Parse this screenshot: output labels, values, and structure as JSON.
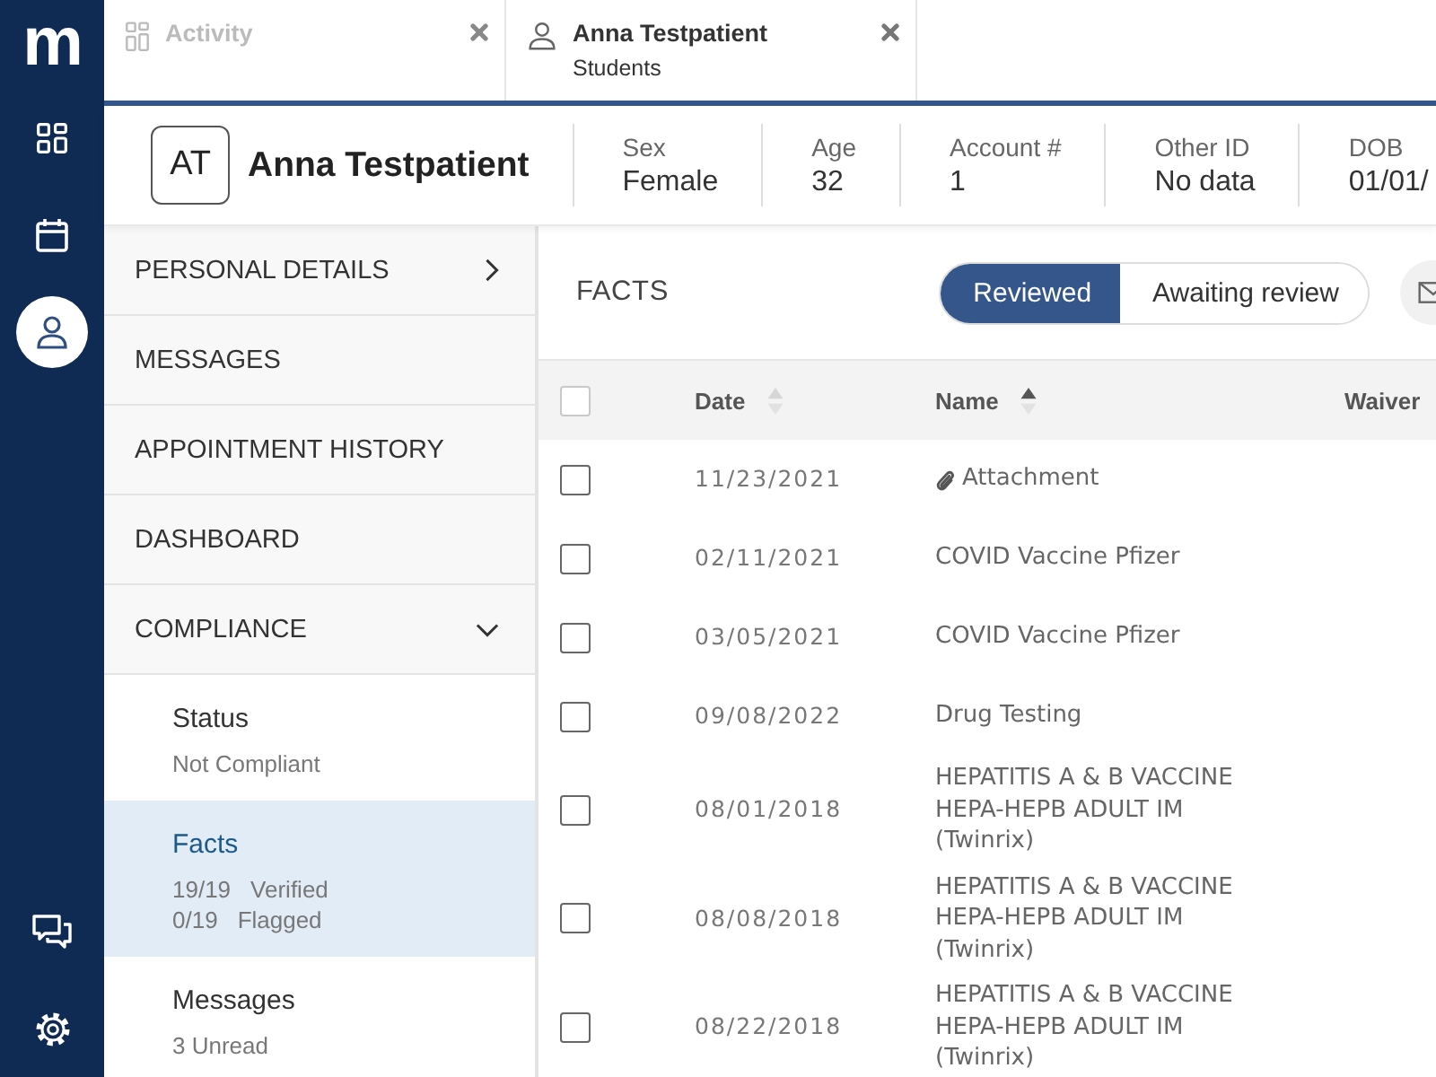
{
  "rail": {
    "logo": "m",
    "items": [
      {
        "selected": false
      },
      {
        "selected": false
      },
      {
        "selected": true
      }
    ]
  },
  "tabs": [
    {
      "label": "Activity",
      "selected": false
    },
    {
      "label": "Anna Testpatient",
      "sublabel": "Students",
      "selected": true
    }
  ],
  "patient": {
    "initials": "AT",
    "name": "Anna Testpatient",
    "fields": [
      {
        "label": "Sex",
        "value": "Female"
      },
      {
        "label": "Age",
        "value": "32"
      },
      {
        "label": "Account #",
        "value": "1"
      },
      {
        "label": "Other ID",
        "value": "No data"
      },
      {
        "label": "DOB",
        "value": "01/01/"
      }
    ]
  },
  "sidebar": {
    "items": [
      {
        "label": "PERSONAL DETAILS",
        "kind": "section",
        "expanded": false
      },
      {
        "label": "MESSAGES",
        "kind": "link"
      },
      {
        "label": "APPOINTMENT HISTORY",
        "kind": "link"
      },
      {
        "label": "DASHBOARD",
        "kind": "link"
      },
      {
        "label": "COMPLIANCE",
        "kind": "section",
        "expanded": true,
        "children": [
          {
            "title": "Status",
            "details": [
              {
                "text": "Not Compliant"
              }
            ],
            "selected": false
          },
          {
            "title": "Facts",
            "details": [
              {
                "count": "19/19",
                "text": "Verified"
              },
              {
                "count": "0/19",
                "text": "Flagged"
              }
            ],
            "selected": true
          },
          {
            "title": "Messages",
            "details": [
              {
                "text": "3 Unread"
              }
            ],
            "selected": false
          }
        ]
      }
    ]
  },
  "facts": {
    "title": "FACTS",
    "filters": [
      {
        "label": "Reviewed",
        "selected": true
      },
      {
        "label": "Awaiting review",
        "selected": false
      }
    ],
    "table": {
      "select_all": false,
      "columns": [
        {
          "label": "Date",
          "sortable": true,
          "sorted": false
        },
        {
          "label": "Name",
          "sortable": true,
          "sorted": true
        },
        {
          "label": "Waiver",
          "sortable": false
        }
      ],
      "rows": [
        {
          "checked": false,
          "date": "11/23/2021",
          "name": "Attachment",
          "attachment": true
        },
        {
          "checked": false,
          "date": "02/11/2021",
          "name": "COVID Vaccine Pfizer",
          "attachment": false
        },
        {
          "checked": false,
          "date": "03/05/2021",
          "name": "COVID Vaccine Pfizer",
          "attachment": false
        },
        {
          "checked": false,
          "date": "09/08/2022",
          "name": "Drug Testing",
          "attachment": false
        },
        {
          "checked": false,
          "date": "08/01/2018",
          "name": "HEPATITIS A & B VACCINE HEPA-HEPB ADULT IM (Twinrix)",
          "attachment": false
        },
        {
          "checked": false,
          "date": "08/08/2018",
          "name": "HEPATITIS A & B VACCINE HEPA-HEPB ADULT IM (Twinrix)",
          "attachment": false
        },
        {
          "checked": false,
          "date": "08/22/2018",
          "name": "HEPATITIS A & B VACCINE HEPA-HEPB ADULT IM (Twinrix)",
          "attachment": false
        }
      ]
    }
  }
}
